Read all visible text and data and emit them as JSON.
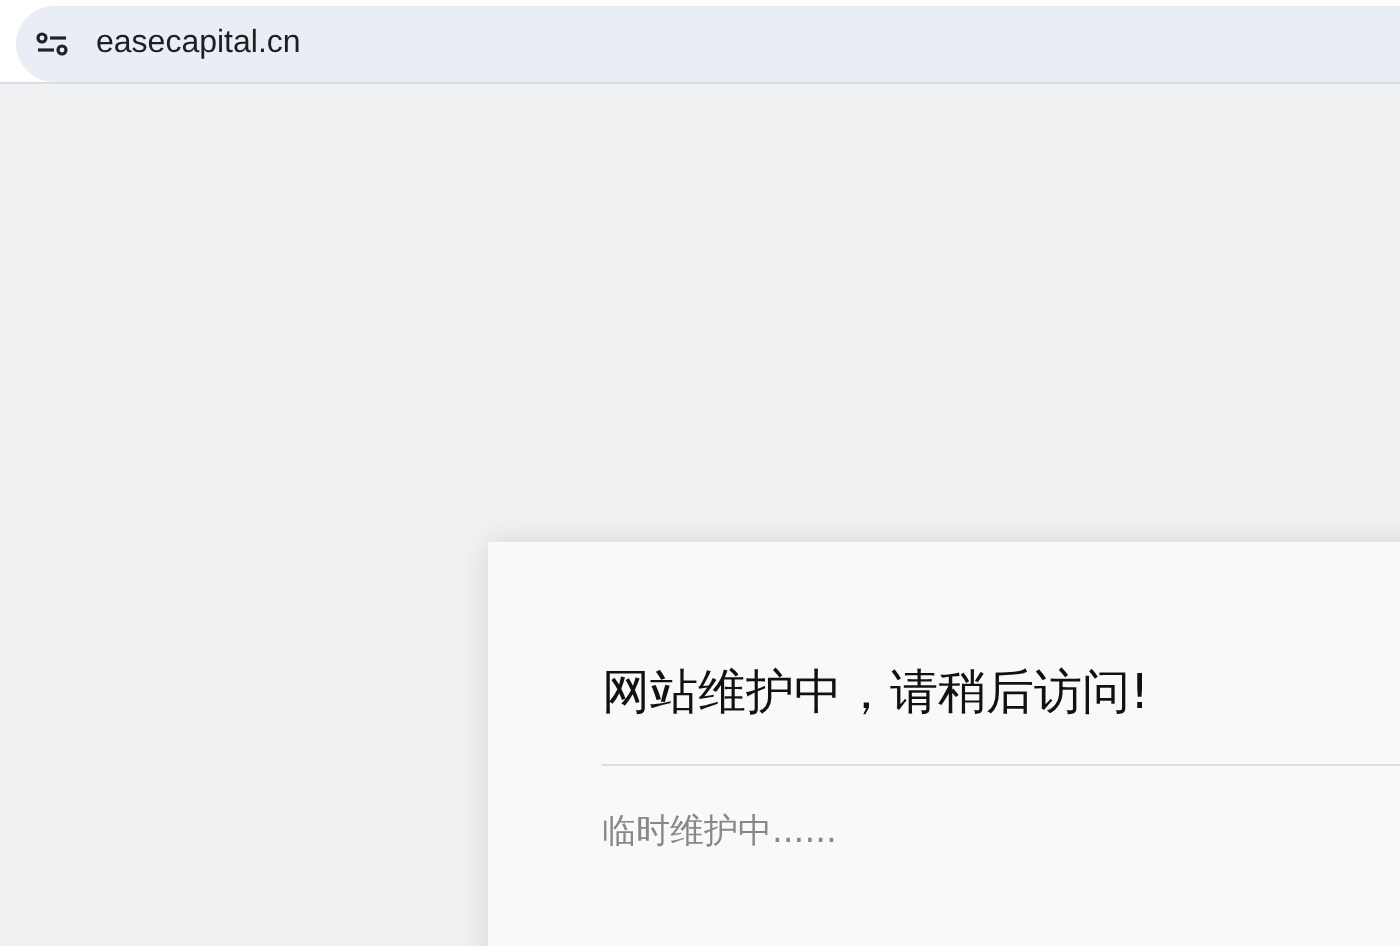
{
  "address_bar": {
    "url": "easecapital.cn"
  },
  "notice": {
    "title": "网站维护中，请稍后访问!",
    "message": "临时维护中......"
  }
}
